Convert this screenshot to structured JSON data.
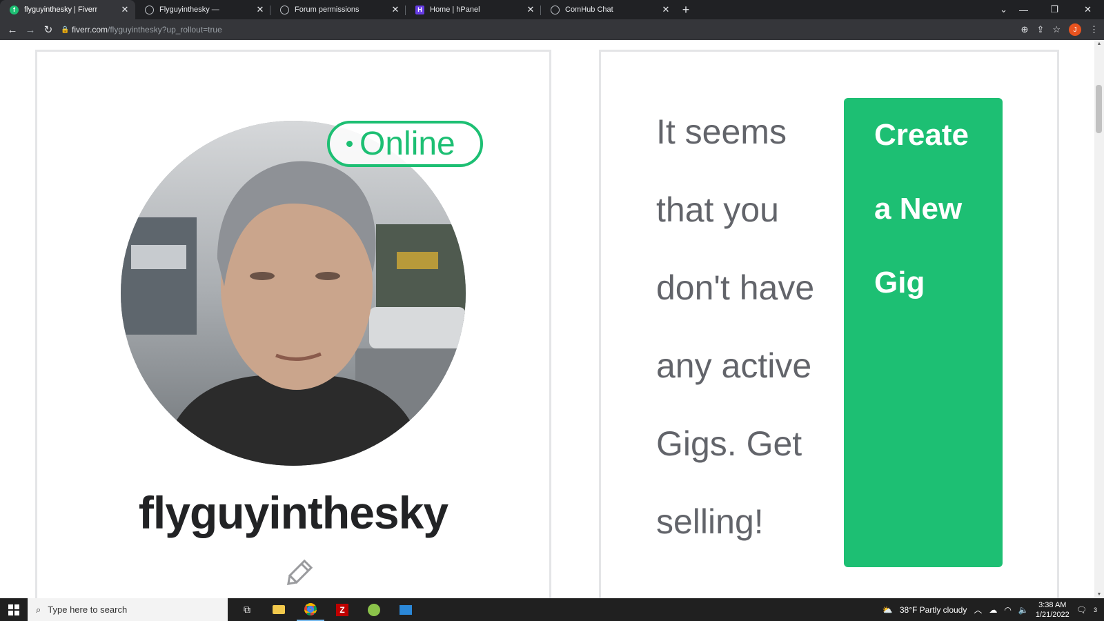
{
  "browser": {
    "tabs": [
      {
        "title": "flyguyinthesky | Fiverr",
        "icon": "fiverr-icon",
        "color": "#1dbf73",
        "active": true
      },
      {
        "title": "Flyguyinthesky —",
        "icon": "globe-icon",
        "color": "#5f6368",
        "active": false
      },
      {
        "title": "Forum permissions",
        "icon": "globe-icon",
        "color": "#5f6368",
        "active": false
      },
      {
        "title": "Home | hPanel",
        "icon": "hostinger-icon",
        "color": "#673de6",
        "active": false
      },
      {
        "title": "ComHub Chat",
        "icon": "globe-icon",
        "color": "#5f6368",
        "active": false
      }
    ],
    "url_host": "fiverr.com",
    "url_path": "/flyguyinthesky?up_rollout=true",
    "profile_initial": "J"
  },
  "profile": {
    "status": "Online",
    "username": "flyguyinthesky"
  },
  "gigs": {
    "message": "It seems that you don't have any active Gigs. Get selling!",
    "message_lines": [
      "It seems",
      "that you",
      "don't have",
      "any active",
      "Gigs. Get",
      "selling!"
    ],
    "create_lines": [
      "Create",
      "a New",
      "Gig"
    ]
  },
  "taskbar": {
    "search_placeholder": "Type here to search",
    "weather": "38°F  Partly cloudy",
    "time": "3:38 AM",
    "date": "1/21/2022",
    "notification_count": "3"
  },
  "colors": {
    "fiverr_green": "#1dbf73",
    "text_gray": "#62646a",
    "username_dark": "#222325"
  }
}
